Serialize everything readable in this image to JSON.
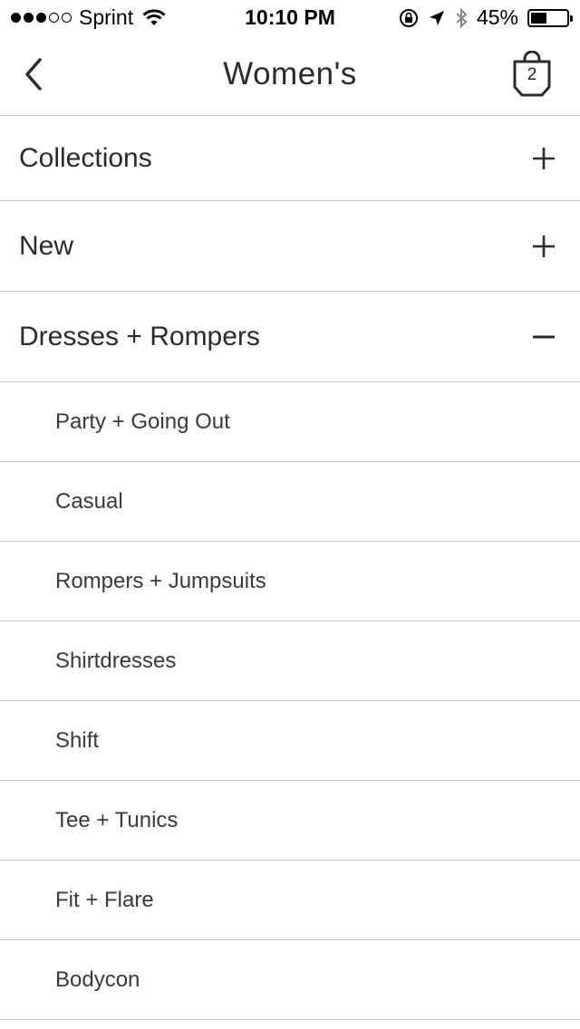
{
  "status_bar": {
    "carrier": "Sprint",
    "time": "10:10 PM",
    "battery_percent": "45%",
    "battery_level": 0.45,
    "signal_bars_filled": 3,
    "signal_bars_total": 5,
    "icons": [
      "wifi-icon",
      "orientation-lock-icon",
      "location-arrow-icon",
      "bluetooth-icon",
      "battery-icon"
    ]
  },
  "nav": {
    "title": "Women's",
    "back_icon": "chevron-left-icon",
    "cart_icon": "shopping-bag-icon",
    "cart_count": "2"
  },
  "categories": [
    {
      "label": "Collections",
      "toggle": "+",
      "expanded": false
    },
    {
      "label": "New",
      "toggle": "+",
      "expanded": false
    },
    {
      "label": "Dresses + Rompers",
      "toggle": "−",
      "expanded": true
    }
  ],
  "subcategories": [
    {
      "label": "Party + Going Out"
    },
    {
      "label": "Casual"
    },
    {
      "label": "Rompers + Jumpsuits"
    },
    {
      "label": "Shirtdresses"
    },
    {
      "label": "Shift"
    },
    {
      "label": "Tee + Tunics"
    },
    {
      "label": "Fit + Flare"
    },
    {
      "label": "Bodycon"
    }
  ],
  "colors": {
    "divider": "#c8c8c8",
    "text": "#2b2b2b"
  }
}
